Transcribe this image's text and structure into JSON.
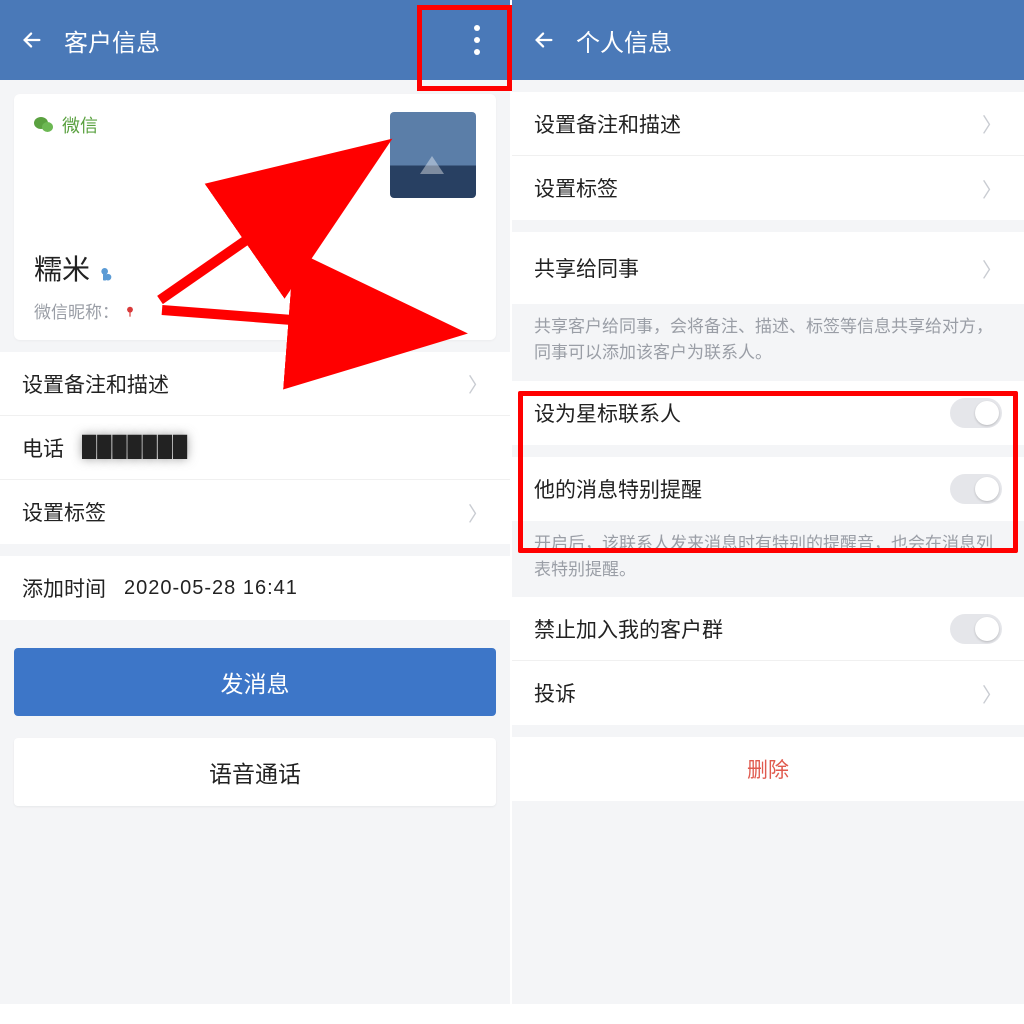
{
  "left": {
    "header_title": "客户信息",
    "card": {
      "channel_label": "微信",
      "name": "糯米",
      "nickname_label": "微信昵称："
    },
    "rows": {
      "remark": "设置备注和描述",
      "phone_label": "电话",
      "phone_value": "███████",
      "tags": "设置标签",
      "add_time_label": "添加时间",
      "add_time_value": "2020-05-28 16:41"
    },
    "btn_send": "发消息",
    "btn_voice": "语音通话"
  },
  "right": {
    "header_title": "个人信息",
    "rows": {
      "remark": "设置备注和描述",
      "tags": "设置标签",
      "share": "共享给同事",
      "share_desc": "共享客户给同事，会将备注、描述、标签等信息共享给对方，同事可以添加该客户为联系人。",
      "star": "设为星标联系人",
      "special": "他的消息特别提醒",
      "special_desc": "开启后，该联系人发来消息时有特别的提醒音，也会在消息列表特别提醒。",
      "block_group": "禁止加入我的客户群",
      "complain": "投诉",
      "delete": "删除"
    }
  }
}
